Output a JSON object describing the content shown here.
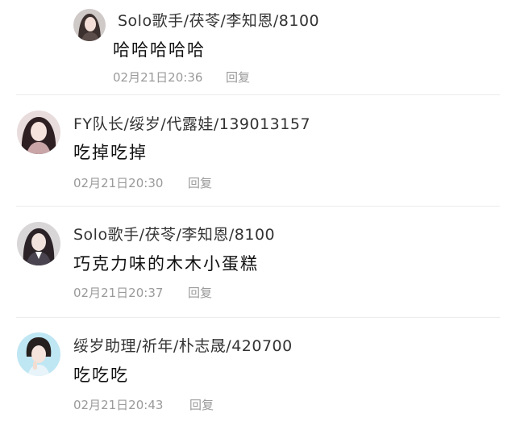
{
  "comments": [
    {
      "name": "Solo歌手/茯苓/李知恩/8100",
      "text": "哈哈哈哈哈",
      "time": "02月21日20:36",
      "reply": "回复"
    },
    {
      "name": "FY队长/绥岁/代露娃/139013157",
      "text": "吃掉吃掉",
      "time": "02月21日20:30",
      "reply": "回复"
    },
    {
      "name": "Solo歌手/茯苓/李知恩/8100",
      "text": "巧克力味的木木小蛋糕",
      "time": "02月21日20:37",
      "reply": "回复"
    },
    {
      "name": "绥岁助理/祈年/朴志晟/420700",
      "text": "吃吃吃",
      "time": "02月21日20:43",
      "reply": "回复"
    }
  ]
}
